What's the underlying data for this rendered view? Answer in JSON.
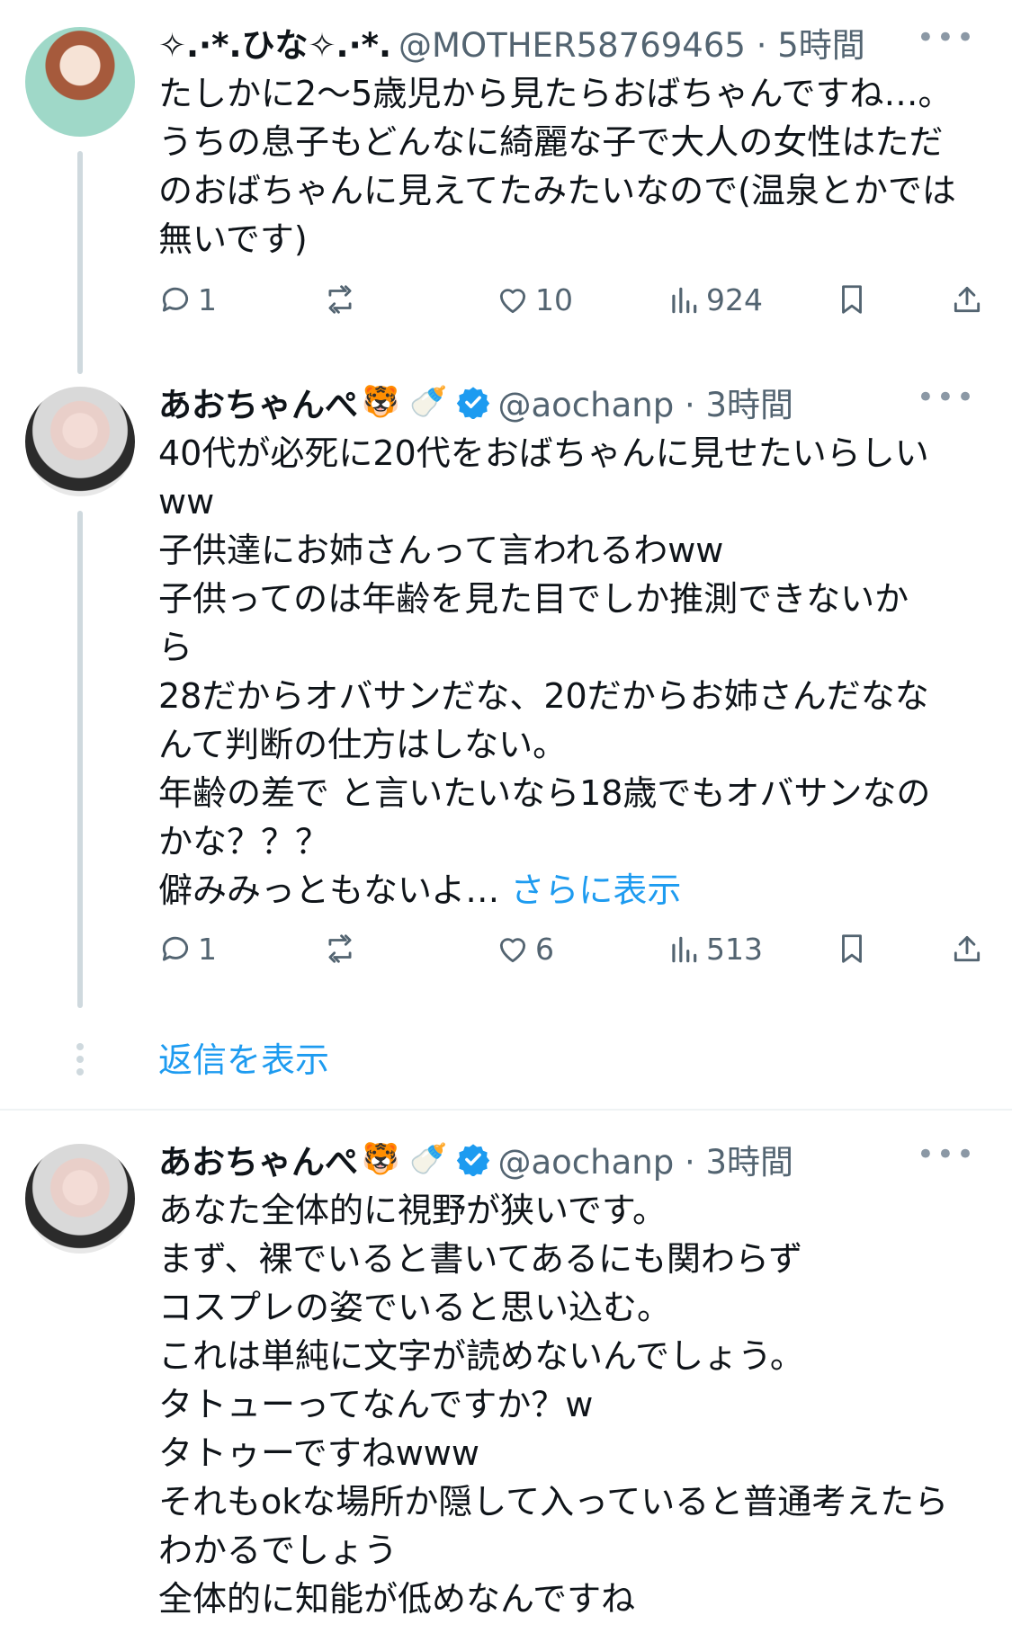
{
  "tweets": [
    {
      "name": "✧.·*.ひな✧.·*.",
      "handle": "@MOTHER58769465 · 5時間",
      "emoji": "",
      "verified": false,
      "text": "たしかに2〜5歳児から見たらおばちゃんですね…。\nうちの息子もどんなに綺麗な子で大人の女性はただ\nのおばちゃんに見えてたみたいなので(温泉とかでは\n無いです)",
      "replies": "1",
      "retweets": "",
      "likes": "10",
      "views": "924"
    },
    {
      "name": "あおちゃんぺ",
      "handle": "@aochanp · 3時間",
      "emoji": "🐯 🍼",
      "verified": true,
      "text": "40代が必死に20代をおばちゃんに見せたいらしい\nww\n子供達にお姉さんって言われるわww\n子供ってのは年齢を見た目でしか推測できないか\nら\n28だからオバサンだな、20だからお姉さんだなな\nんて判断の仕方はしない。\n年齢の差で と言いたいなら18歳でもオバサンなの\nかな？？？\n僻みみっともないよ… ",
      "show_more": "さらに表示",
      "replies": "1",
      "retweets": "",
      "likes": "6",
      "views": "513"
    },
    {
      "name": "あおちゃんぺ",
      "handle": "@aochanp · 3時間",
      "emoji": "🐯 🍼",
      "verified": true,
      "text": "あなた全体的に視野が狭いです。\nまず、裸でいると書いてあるにも関わらず\nコスプレの姿でいると思い込む。\nこれは単純に文字が読めないんでしょう。\nタトューってなんですか？w\nタトゥーですねwww\nそれもokな場所か隠して入っていると普通考えたら\nわかるでしょう\n全体的に知能が低めなんですね"
    }
  ],
  "show_replies_label": "返信を表示",
  "more_label": "•••",
  "colors": {
    "text": "#0f1419",
    "muted": "#536471",
    "accent": "#1d9bf0",
    "line": "#cfd9de"
  }
}
